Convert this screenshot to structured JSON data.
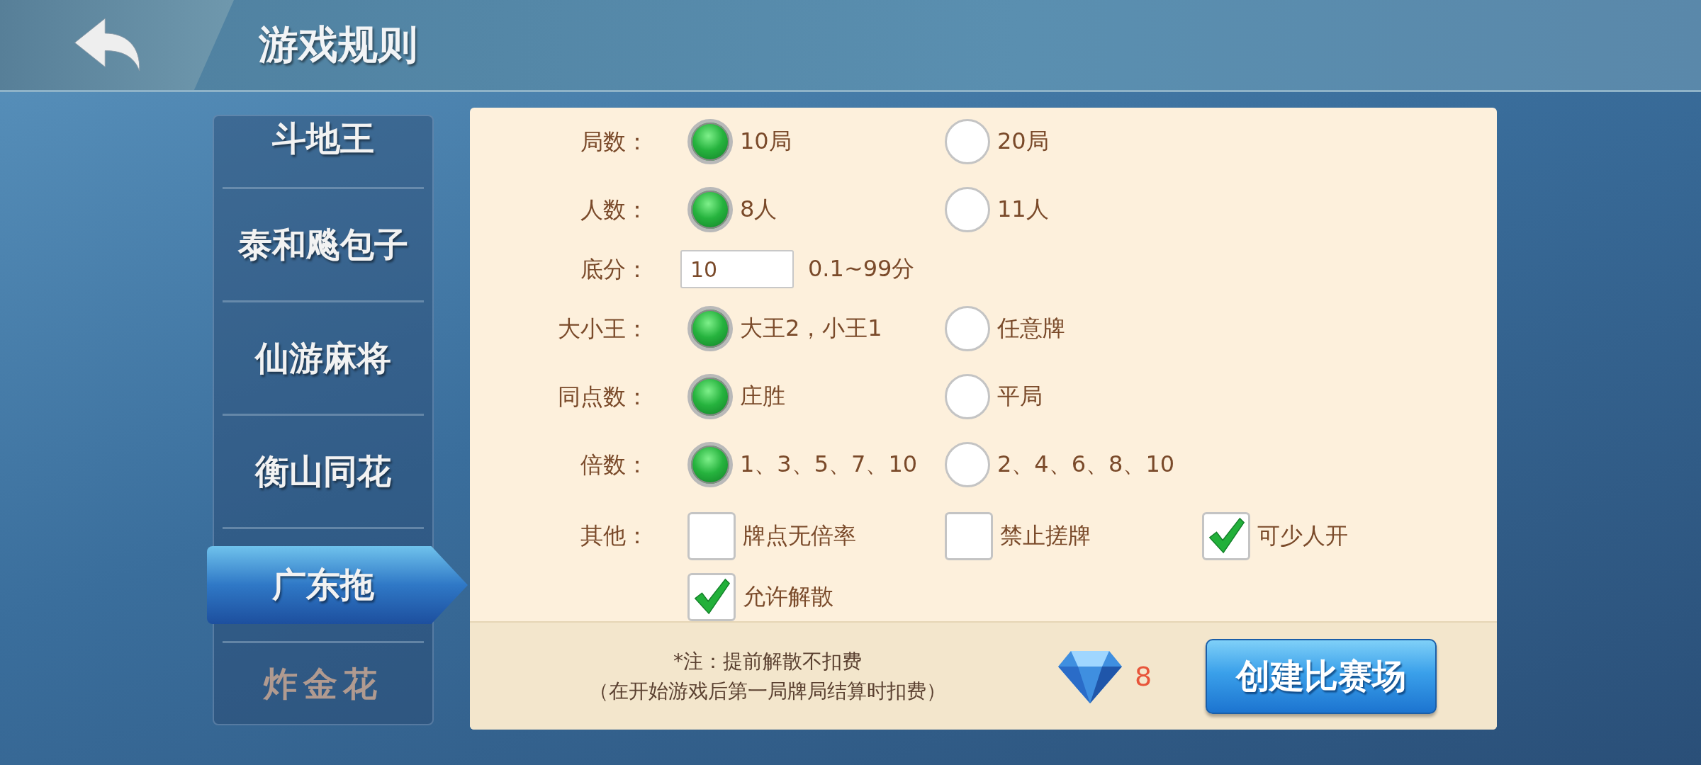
{
  "header": {
    "title": "游戏规则"
  },
  "sidebar": {
    "items": [
      {
        "label": "斗地王",
        "selected": false,
        "disabled": false
      },
      {
        "label": "泰和飚包子",
        "selected": false,
        "disabled": false
      },
      {
        "label": "仙游麻将",
        "selected": false,
        "disabled": false
      },
      {
        "label": "衡山同花",
        "selected": false,
        "disabled": false
      },
      {
        "label": "广东拖",
        "selected": true,
        "disabled": false
      },
      {
        "label": "炸金花",
        "selected": false,
        "disabled": true
      }
    ]
  },
  "rules": [
    {
      "label": "局数：",
      "kind": "radio",
      "options": [
        {
          "label": "10局",
          "selected": true
        },
        {
          "label": "20局",
          "selected": false
        }
      ]
    },
    {
      "label": "人数：",
      "kind": "radio",
      "options": [
        {
          "label": "8人",
          "selected": true
        },
        {
          "label": "11人",
          "selected": false
        }
      ]
    },
    {
      "label": "底分：",
      "kind": "input",
      "value": "10",
      "hint": "0.1~99分"
    },
    {
      "label": "大小王：",
      "kind": "radio",
      "options": [
        {
          "label": "大王2，小王1",
          "selected": true
        },
        {
          "label": "任意牌",
          "selected": false
        }
      ]
    },
    {
      "label": "同点数：",
      "kind": "radio",
      "options": [
        {
          "label": "庄胜",
          "selected": true
        },
        {
          "label": "平局",
          "selected": false
        }
      ]
    },
    {
      "label": "倍数：",
      "kind": "radio",
      "options": [
        {
          "label": "1、3、5、7、10",
          "selected": true
        },
        {
          "label": "2、4、6、8、10",
          "selected": false
        }
      ]
    },
    {
      "label": "其他：",
      "kind": "checkbox",
      "options": [
        {
          "label": "牌点无倍率",
          "checked": false
        },
        {
          "label": "禁止搓牌",
          "checked": false
        },
        {
          "label": "可少人开",
          "checked": true
        },
        {
          "label": "允许解散",
          "checked": true
        }
      ]
    }
  ],
  "footer": {
    "note": [
      "*注：提前解散不扣费",
      "（在开始游戏后第一局牌局结算时扣费）"
    ],
    "cost": "8",
    "create_button": "创建比赛场"
  }
}
